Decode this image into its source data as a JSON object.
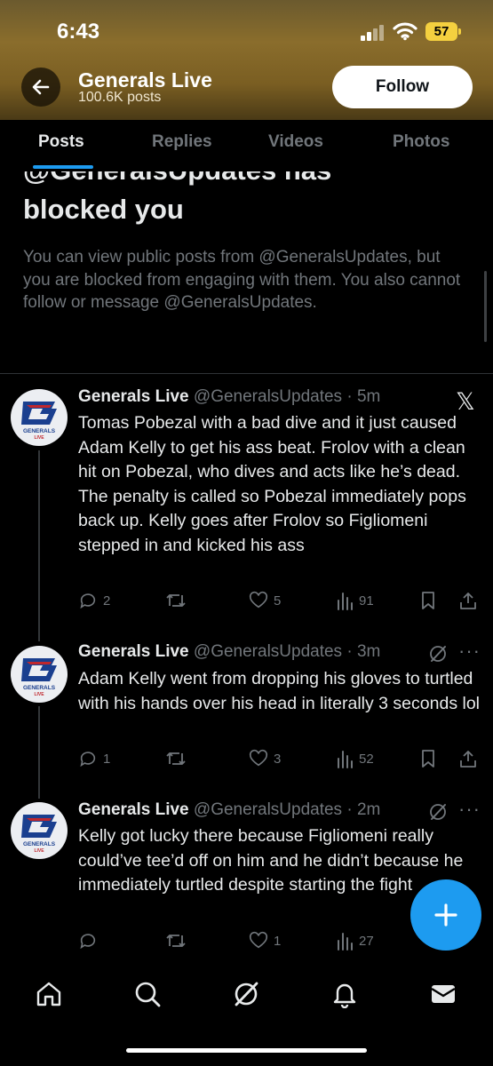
{
  "status_bar": {
    "time": "6:43",
    "battery": "57"
  },
  "header": {
    "account_name": "Generals Live",
    "post_count": "100.6K posts",
    "follow_label": "Follow"
  },
  "tabs": [
    {
      "label": "Posts"
    },
    {
      "label": "Replies"
    },
    {
      "label": "Videos"
    },
    {
      "label": "Photos"
    }
  ],
  "blocked": {
    "title_line1": "@GeneralsUpdates has",
    "title_line2": "blocked you",
    "body": "You can view public posts from @GeneralsUpdates, but you are blocked from engaging with them. You also cannot follow or message @GeneralsUpdates."
  },
  "tweets": [
    {
      "name": "Generals Live",
      "handle_time": "@GeneralsUpdates · 5m",
      "text": "Tomas Pobezal with a bad dive and it just caused Adam Kelly to get his ass beat. Frolov with a clean hit on Pobezal, who dives and acts like he’s dead. The penalty is called so Pobezal immediately pops back up. Kelly goes after Frolov so Figliomeni stepped in and kicked his ass",
      "replies": "2",
      "likes": "5",
      "views": "91"
    },
    {
      "name": "Generals Live",
      "handle_time": "@GeneralsUpdates · 3m",
      "text": "Adam Kelly went from dropping his gloves to turtled with his hands over his head in literally 3 seconds lol",
      "replies": "1",
      "likes": "3",
      "views": "52"
    },
    {
      "name": "Generals Live",
      "handle_time": "@GeneralsUpdates · 2m",
      "text": "Kelly got lucky there because Figliomeni really could’ve tee’d off on him and he didn’t because he immediately turtled despite starting the fight",
      "replies": "",
      "likes": "1",
      "views": "27"
    }
  ],
  "avatar_text": "GENERALS LIVE",
  "icons": {
    "back": "arrow-left-icon",
    "fab": "plus-icon",
    "nav": [
      "home-icon",
      "search-icon",
      "grok-icon",
      "bell-icon",
      "mail-icon"
    ]
  },
  "colors": {
    "accent": "#1d9bf0",
    "background": "#000000",
    "muted": "#71767b",
    "battery": "#f4d03f"
  }
}
